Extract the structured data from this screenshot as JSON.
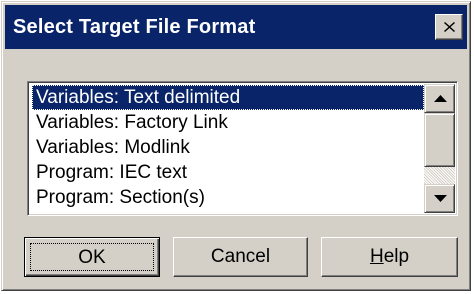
{
  "window": {
    "title": "Select Target File Format",
    "close_label": "×"
  },
  "format_list": {
    "selected_index": 0,
    "items": [
      "Variables: Text delimited",
      "Variables: Factory Link",
      "Variables: Modlink",
      "Program: IEC text",
      "Program: Section(s)"
    ]
  },
  "scrollbar": {
    "up_icon": "triangle-up-icon",
    "down_icon": "triangle-down-icon"
  },
  "buttons": {
    "ok_label": "OK",
    "cancel_label": "Cancel",
    "help_mnemonic": "H",
    "help_rest": "elp"
  },
  "colors": {
    "titlebar": "#0a246a",
    "face": "#d4d0c8",
    "selection": "#0a246a"
  }
}
